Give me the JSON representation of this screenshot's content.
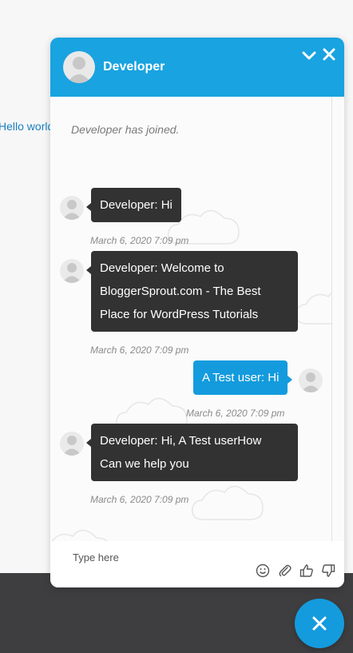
{
  "page": {
    "link_text": "Hello world"
  },
  "chat": {
    "header": {
      "title": "Developer"
    },
    "joined_notice": "Developer has joined.",
    "messages": [
      {
        "sender": "agent",
        "lines": [
          "Developer: Hi"
        ],
        "time": "March 6, 2020 7:09 pm"
      },
      {
        "sender": "agent",
        "lines": [
          "Developer: Welcome to",
          "BloggerSprout.com - The Best",
          "Place for WordPress Tutorials"
        ],
        "time": "March 6, 2020 7:09 pm"
      },
      {
        "sender": "user",
        "lines": [
          "A Test user: Hi"
        ],
        "time": "March 6, 2020 7:09 pm"
      },
      {
        "sender": "agent",
        "lines": [
          "Developer: Hi, A Test userHow",
          "Can we help you"
        ],
        "time": "March 6, 2020 7:09 pm"
      }
    ],
    "input": {
      "placeholder": "Type here",
      "value": ""
    },
    "toolbar_icons": [
      "smiley-icon",
      "paperclip-icon",
      "thumbs-up-icon",
      "thumbs-down-icon"
    ]
  },
  "colors": {
    "header_bg": "#19a3e0",
    "agent_bubble": "#323232",
    "user_bubble": "#149bdd",
    "link": "#1a7fc1"
  }
}
